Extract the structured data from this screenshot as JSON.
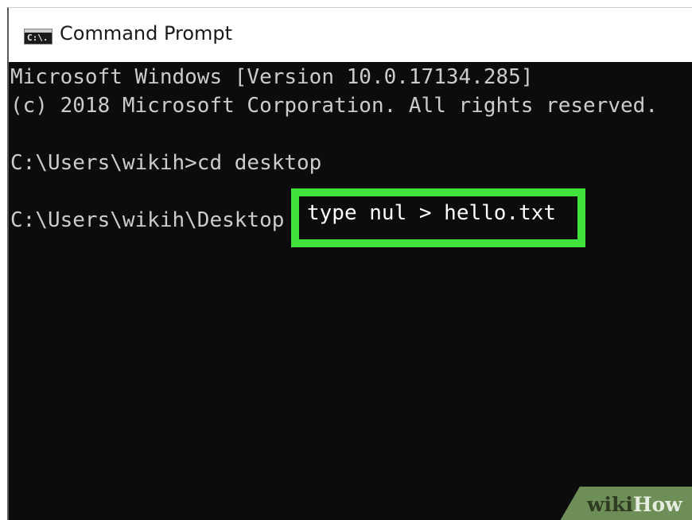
{
  "window": {
    "title": "Command Prompt",
    "icon": "cmd-console-icon",
    "icon_glyph": "C:\\."
  },
  "console": {
    "lines": [
      "Microsoft Windows [Version 10.0.17134.285]",
      "(c) 2018 Microsoft Corporation. All rights reserved.",
      "",
      "C:\\Users\\wikih>cd desktop",
      "",
      "C:\\Users\\wikih\\Desktop"
    ],
    "current_command": "type nul > hello.txt"
  },
  "colors": {
    "console_background": "#0c0c0c",
    "console_text": "#cccccc",
    "highlight_border": "#3ee23a",
    "watermark_band": "#6e8e58"
  },
  "watermark": {
    "part1": "wiki",
    "part2": "How"
  }
}
